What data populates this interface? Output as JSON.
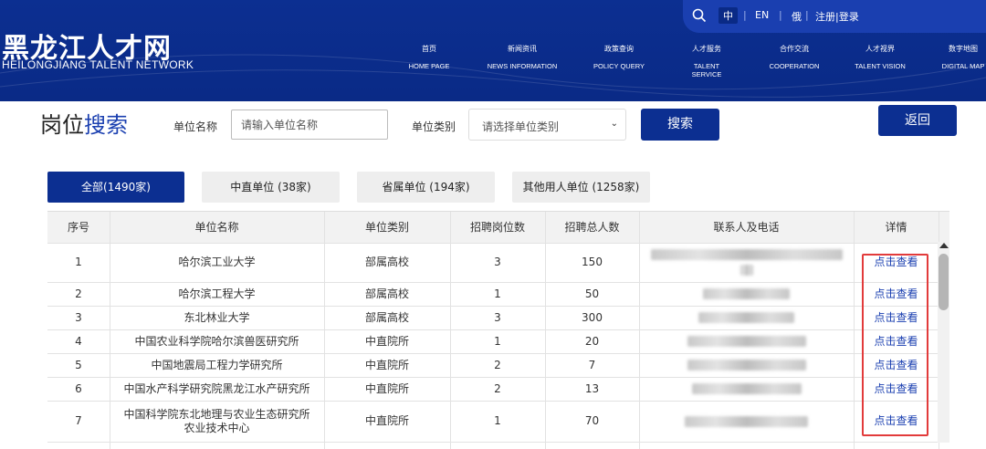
{
  "header": {
    "logo_cn": "黑龙江人才网",
    "logo_en": "HEILONGJIANG TALENT NETWORK",
    "lang_zh": "中",
    "lang_en": "EN",
    "lang_ru": "俄",
    "sep": "|",
    "auth": "注册|登录",
    "nav": [
      {
        "cn": "首页",
        "en": "HOME PAGE"
      },
      {
        "cn": "新闻资讯",
        "en": "NEWS INFORMATION"
      },
      {
        "cn": "政策查询",
        "en": "POLICY QUERY"
      },
      {
        "cn": "人才服务",
        "en": "TALENT SERVICE"
      },
      {
        "cn": "合作交流",
        "en": "COOPERATION"
      },
      {
        "cn": "人才视界",
        "en": "TALENT VISION"
      },
      {
        "cn": "数字地图",
        "en": "DIGITAL MAP"
      }
    ]
  },
  "search": {
    "title_a": "岗位",
    "title_b": "搜索",
    "unit_name_label": "单位名称",
    "unit_name_placeholder": "请输入单位名称",
    "unit_type_label": "单位类别",
    "unit_type_selected": "请选择单位类别",
    "search_button": "搜索",
    "back_button": "返回"
  },
  "tabs": [
    {
      "label": "全部(1490家)",
      "active": true
    },
    {
      "label": "中直单位 (38家)",
      "active": false
    },
    {
      "label": "省属单位 (194家)",
      "active": false
    },
    {
      "label": "其他用人单位 (1258家)",
      "active": false
    }
  ],
  "table": {
    "headers": [
      "序号",
      "单位名称",
      "单位类别",
      "招聘岗位数",
      "招聘总人数",
      "联系人及电话",
      "详情"
    ],
    "detail_link": "点击查看",
    "rows": [
      {
        "no": "1",
        "name": "哈尔滨工业大学",
        "type": "部属高校",
        "posts": "3",
        "total": "150"
      },
      {
        "no": "2",
        "name": "哈尔滨工程大学",
        "type": "部属高校",
        "posts": "1",
        "total": "50"
      },
      {
        "no": "3",
        "name": "东北林业大学",
        "type": "部属高校",
        "posts": "3",
        "total": "300"
      },
      {
        "no": "4",
        "name": "中国农业科学院哈尔滨兽医研究所",
        "type": "中直院所",
        "posts": "1",
        "total": "20"
      },
      {
        "no": "5",
        "name": "中国地震局工程力学研究所",
        "type": "中直院所",
        "posts": "2",
        "total": "7"
      },
      {
        "no": "6",
        "name": "中国水产科学研究院黑龙江水产研究所",
        "type": "中直院所",
        "posts": "2",
        "total": "13"
      },
      {
        "no": "7",
        "name": "中国科学院东北地理与农业生态研究所农业技术中心",
        "type": "中直院所",
        "posts": "1",
        "total": "70"
      }
    ]
  }
}
